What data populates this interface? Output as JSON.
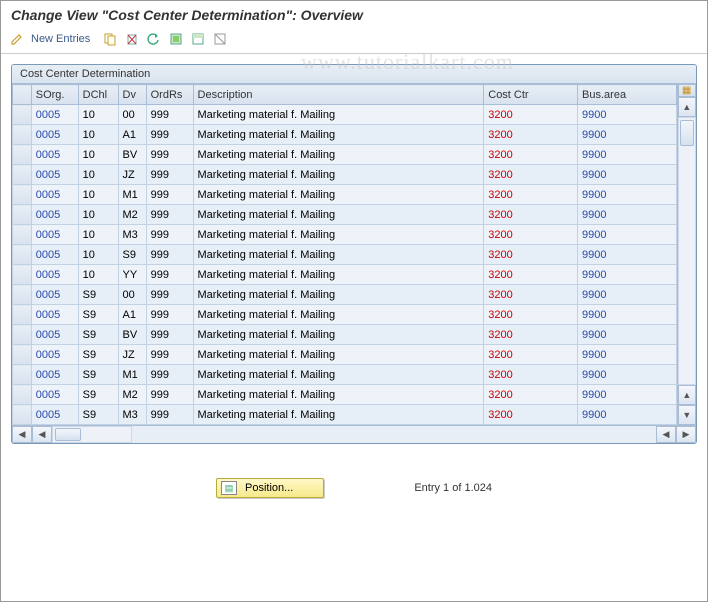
{
  "title": "Change View \"Cost Center Determination\": Overview",
  "watermark": "www.tutorialkart.com",
  "toolbar": {
    "new_entries": "New Entries",
    "icons": {
      "edit": "edit-pencil-icon",
      "copy": "copy-icon",
      "delete": "delete-icon",
      "undo": "undo-icon",
      "select_all": "select-all-icon",
      "select_block": "select-block-icon",
      "deselect": "deselect-icon"
    }
  },
  "panel": {
    "title": "Cost Center Determination",
    "columns": {
      "sel": "",
      "sorg": "SOrg.",
      "dchl": "DChl",
      "dv": "Dv",
      "ordrs": "OrdRs",
      "desc": "Description",
      "costctr": "Cost Ctr",
      "busarea": "Bus.area"
    },
    "rows": [
      {
        "sorg": "0005",
        "dchl": "10",
        "dv": "00",
        "ordrs": "999",
        "desc": "Marketing material f. Mailing",
        "cost": "3200",
        "bus": "9900"
      },
      {
        "sorg": "0005",
        "dchl": "10",
        "dv": "A1",
        "ordrs": "999",
        "desc": "Marketing material f. Mailing",
        "cost": "3200",
        "bus": "9900"
      },
      {
        "sorg": "0005",
        "dchl": "10",
        "dv": "BV",
        "ordrs": "999",
        "desc": "Marketing material f. Mailing",
        "cost": "3200",
        "bus": "9900"
      },
      {
        "sorg": "0005",
        "dchl": "10",
        "dv": "JZ",
        "ordrs": "999",
        "desc": "Marketing material f. Mailing",
        "cost": "3200",
        "bus": "9900"
      },
      {
        "sorg": "0005",
        "dchl": "10",
        "dv": "M1",
        "ordrs": "999",
        "desc": "Marketing material f. Mailing",
        "cost": "3200",
        "bus": "9900"
      },
      {
        "sorg": "0005",
        "dchl": "10",
        "dv": "M2",
        "ordrs": "999",
        "desc": "Marketing material f. Mailing",
        "cost": "3200",
        "bus": "9900"
      },
      {
        "sorg": "0005",
        "dchl": "10",
        "dv": "M3",
        "ordrs": "999",
        "desc": "Marketing material f. Mailing",
        "cost": "3200",
        "bus": "9900"
      },
      {
        "sorg": "0005",
        "dchl": "10",
        "dv": "S9",
        "ordrs": "999",
        "desc": "Marketing material f. Mailing",
        "cost": "3200",
        "bus": "9900"
      },
      {
        "sorg": "0005",
        "dchl": "10",
        "dv": "YY",
        "ordrs": "999",
        "desc": "Marketing material f. Mailing",
        "cost": "3200",
        "bus": "9900"
      },
      {
        "sorg": "0005",
        "dchl": "S9",
        "dv": "00",
        "ordrs": "999",
        "desc": "Marketing material f. Mailing",
        "cost": "3200",
        "bus": "9900"
      },
      {
        "sorg": "0005",
        "dchl": "S9",
        "dv": "A1",
        "ordrs": "999",
        "desc": "Marketing material f. Mailing",
        "cost": "3200",
        "bus": "9900"
      },
      {
        "sorg": "0005",
        "dchl": "S9",
        "dv": "BV",
        "ordrs": "999",
        "desc": "Marketing material f. Mailing",
        "cost": "3200",
        "bus": "9900"
      },
      {
        "sorg": "0005",
        "dchl": "S9",
        "dv": "JZ",
        "ordrs": "999",
        "desc": "Marketing material f. Mailing",
        "cost": "3200",
        "bus": "9900"
      },
      {
        "sorg": "0005",
        "dchl": "S9",
        "dv": "M1",
        "ordrs": "999",
        "desc": "Marketing material f. Mailing",
        "cost": "3200",
        "bus": "9900"
      },
      {
        "sorg": "0005",
        "dchl": "S9",
        "dv": "M2",
        "ordrs": "999",
        "desc": "Marketing material f. Mailing",
        "cost": "3200",
        "bus": "9900"
      },
      {
        "sorg": "0005",
        "dchl": "S9",
        "dv": "M3",
        "ordrs": "999",
        "desc": "Marketing material f. Mailing",
        "cost": "3200",
        "bus": "9900"
      }
    ]
  },
  "footer": {
    "position_btn": "Position...",
    "entry_text": "Entry 1 of 1.024"
  }
}
